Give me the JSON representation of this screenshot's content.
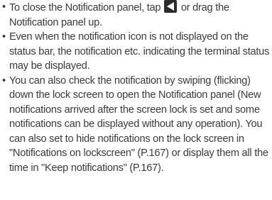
{
  "notes": [
    {
      "bullet": "•",
      "before_icon": "To close the Notification panel, tap ",
      "icon": "back-triangle-icon",
      "after_icon": " or drag the Notification panel up."
    },
    {
      "bullet": "•",
      "text": "Even when the notification icon is not displayed on the status bar, the notification etc. indicating the terminal status may be displayed."
    },
    {
      "bullet": "•",
      "text": "You can also check the notification by swiping (flicking) down the lock screen to open the Notification panel (New notifications arrived after the screen lock is set and some notifications can be displayed without any operation). You can also set to hide notifications on the lock screen in \"Notifications on lockscreen\" (P.167) or display them all the time in \"Keep notifications\" (P.167)."
    }
  ],
  "colors": {
    "text": "#3a3a3a",
    "icon_bg": "#2b2b2b",
    "icon_fg": "#ffffff"
  }
}
